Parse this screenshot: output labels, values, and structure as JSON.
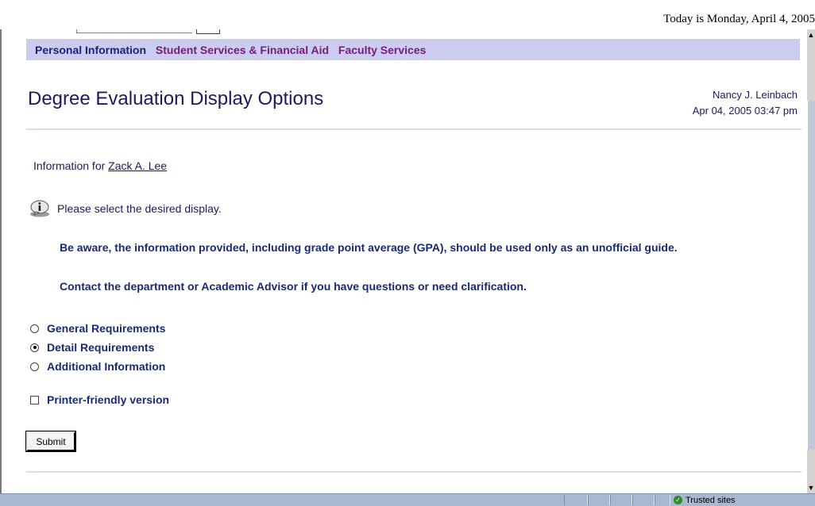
{
  "top_date": "Today is Monday, April 4, 2005",
  "nav": {
    "personal": "Personal Information",
    "student": "Student Services & Financial Aid",
    "faculty": "Faculty Services"
  },
  "page": {
    "title": "Degree Evaluation Display Options",
    "user_name": "Nancy J. Leinbach",
    "timestamp": "Apr 04, 2005 03:47 pm"
  },
  "info": {
    "prefix": "Information for",
    "student_name": "Zack A. Lee"
  },
  "hint": "Please select the desired display.",
  "messages": [
    "Be aware, the information provided, including grade point average (GPA), should be used only as an unofficial guide.",
    "Contact the department or Academic Advisor if you have questions or need clarification."
  ],
  "options": [
    {
      "label": "General Requirements",
      "selected": false
    },
    {
      "label": "Detail Requirements",
      "selected": true
    },
    {
      "label": "Additional Information",
      "selected": false
    }
  ],
  "printer_friendly": {
    "label": "Printer-friendly version",
    "checked": false
  },
  "submit_label": "Submit",
  "status_zone": "Trusted sites"
}
